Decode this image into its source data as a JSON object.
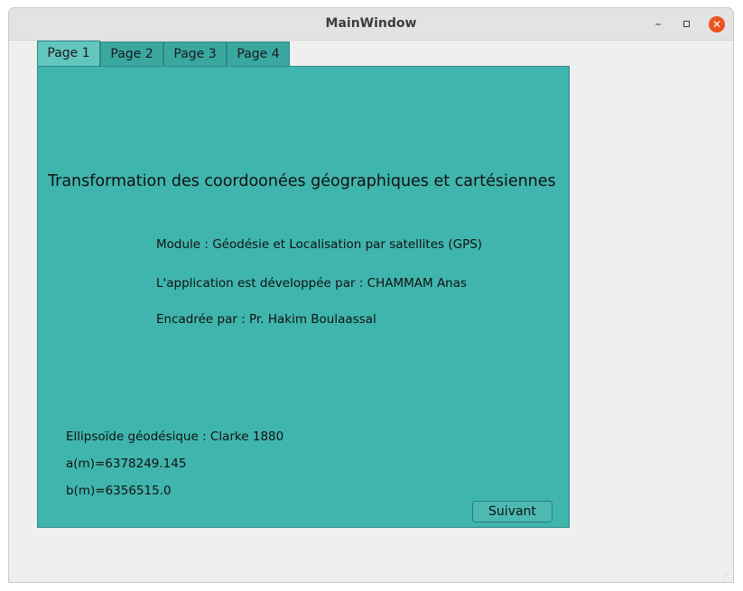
{
  "window": {
    "title": "MainWindow",
    "minimize_glyph": "–",
    "close_glyph": "✕"
  },
  "tabs": [
    {
      "label": "Page 1",
      "active": true
    },
    {
      "label": "Page 2",
      "active": false
    },
    {
      "label": "Page 3",
      "active": false
    },
    {
      "label": "Page 4",
      "active": false
    }
  ],
  "page1": {
    "heading": "Transformation des coordoonées géographiques et cartésiennes",
    "module": "Module : Géodésie et Localisation par satellites (GPS)",
    "developer": "L'application est développée par : CHAMMAM Anas",
    "supervisor": "Encadrée par : Pr. Hakim Boulaassal",
    "ellipsoid": "Ellipsoïde géodésique : Clarke 1880",
    "a_value": "a(m)=6378249.145",
    "b_value": "b(m)=6356515.0",
    "next_button": "Suivant"
  },
  "colors": {
    "panel": "#40b5ad",
    "tab_active": "#63c5be",
    "tab_inactive": "#3aa8a0",
    "close_button": "#e95420"
  },
  "icons": {
    "minimize": "minimize-icon",
    "maximize": "maximize-icon",
    "close": "close-icon",
    "resize": "resize-grip-icon"
  }
}
